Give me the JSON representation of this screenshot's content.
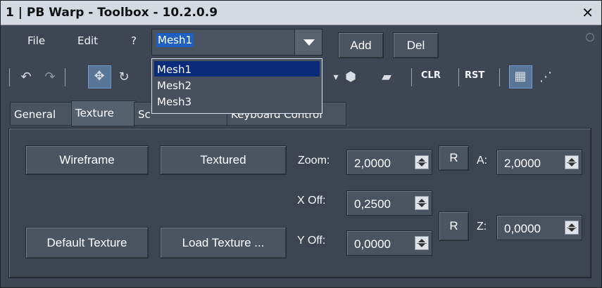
{
  "title": "1 | PB Warp - Toolbox - 10.2.0.9",
  "close_glyph": "✕",
  "menu": {
    "file": "File",
    "edit": "Edit",
    "help": "?"
  },
  "mesh_selector": {
    "value": "Mesh1",
    "options": [
      "Mesh1",
      "Mesh2",
      "Mesh3"
    ]
  },
  "actions": {
    "add": "Add",
    "del": "Del"
  },
  "toolbar": {
    "clr": "CLR",
    "rst": "RST"
  },
  "tabs": {
    "general": "General",
    "texture": "Texture",
    "screen_hidden": "Sc",
    "keyboard_hidden": "Keyboard Control"
  },
  "panel": {
    "buttons": {
      "wireframe": "Wireframe",
      "textured": "Textured",
      "default_texture": "Default Texture",
      "load_texture": "Load Texture ..."
    },
    "labels": {
      "zoom": "Zoom:",
      "a": "A:",
      "x_off": "X Off:",
      "y_off": "Y Off:",
      "z": "Z:",
      "r_top": "R",
      "r_bottom": "R"
    },
    "values": {
      "zoom": "2,0000",
      "a": "2,0000",
      "x_off": "0,2500",
      "y_off": "0,0000",
      "z": "0,0000"
    }
  },
  "colors": {
    "titlebar_bg": "#d5dae2",
    "window_bg": "#3d4652",
    "selection_bg": "#1f5fbf",
    "dropdown_active": "#0a2a7a"
  },
  "icons": [
    "undo-icon",
    "redo-icon",
    "move-icon",
    "rotate-icon",
    "fill-icon",
    "eraser-icon",
    "grid-icon",
    "points-icon"
  ]
}
